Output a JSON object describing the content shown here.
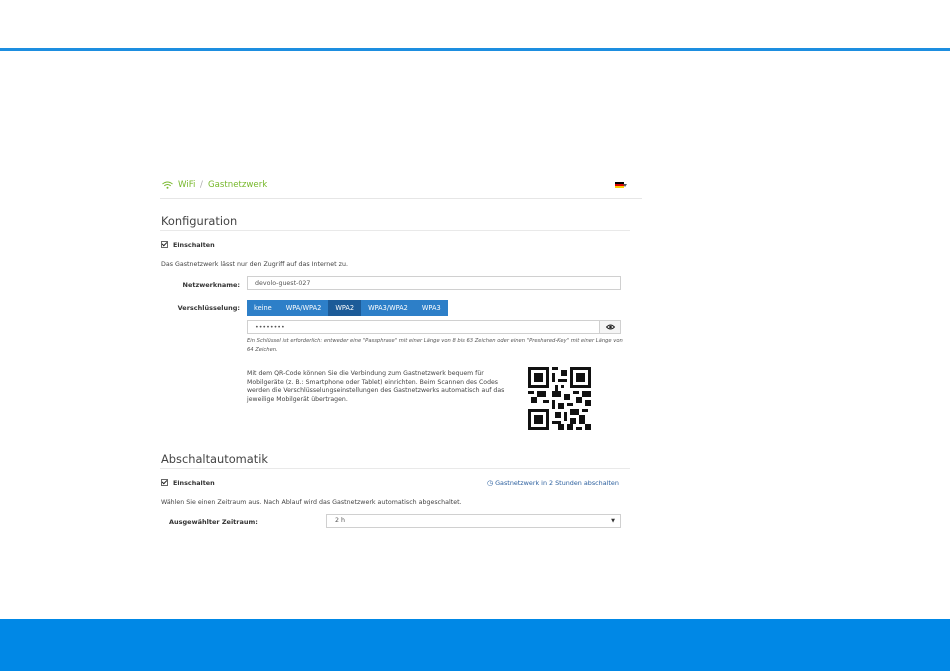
{
  "breadcrumb": {
    "parent": "WiFi",
    "separator": "/",
    "current": "Gastnetzwerk"
  },
  "language": {
    "flag_icon": "german-flag-icon"
  },
  "configuration": {
    "title": "Konfiguration",
    "enable_label": "Einschalten",
    "enabled": true,
    "description": "Das Gastnetzwerk lässt nur den Zugriff auf das Internet zu.",
    "network_name_label": "Netzwerkname:",
    "network_name_value": "devolo-guest-027",
    "encryption_label": "Verschlüsselung:",
    "encryption_options": [
      "keine",
      "WPA/WPA2",
      "WPA2",
      "WPA3/WPA2",
      "WPA3"
    ],
    "encryption_selected": "WPA2",
    "password_value": "••••••••",
    "key_hint": "Ein Schlüssel ist erforderlich: entweder eine \"Passphrase\" mit einer Länge von 8 bis 63 Zeichen oder einen \"Preshared-Key\" mit einer Länge von 64 Zeichen.",
    "qr_text": "Mit dem QR-Code können Sie die Verbindung zum Gastnetzwerk bequem für Mobilgeräte (z. B.: Smartphone oder Tablet) einrichten. Beim Scannen des Codes werden die Verschlüsselungseinstellungen des Gastnetzwerks automatisch auf das jeweilige Mobilgerät übertragen."
  },
  "auto_off": {
    "title": "Abschaltautomatik",
    "enable_label": "Einschalten",
    "enabled": true,
    "status_link": "Gastnetzwerk in 2 Stunden abschalten",
    "description": "Wählen Sie einen Zeitraum aus. Nach Ablauf wird das Gastnetzwerk automatisch abgeschaltet.",
    "period_label": "Ausgewählter Zeitraum:",
    "period_value": "2 h"
  },
  "colors": {
    "accent": "#1d8ee0",
    "footer": "#0088e6",
    "breadcrumb": "#77b82b",
    "segment": "#2d7fc8",
    "segment_active": "#1c5b98"
  }
}
